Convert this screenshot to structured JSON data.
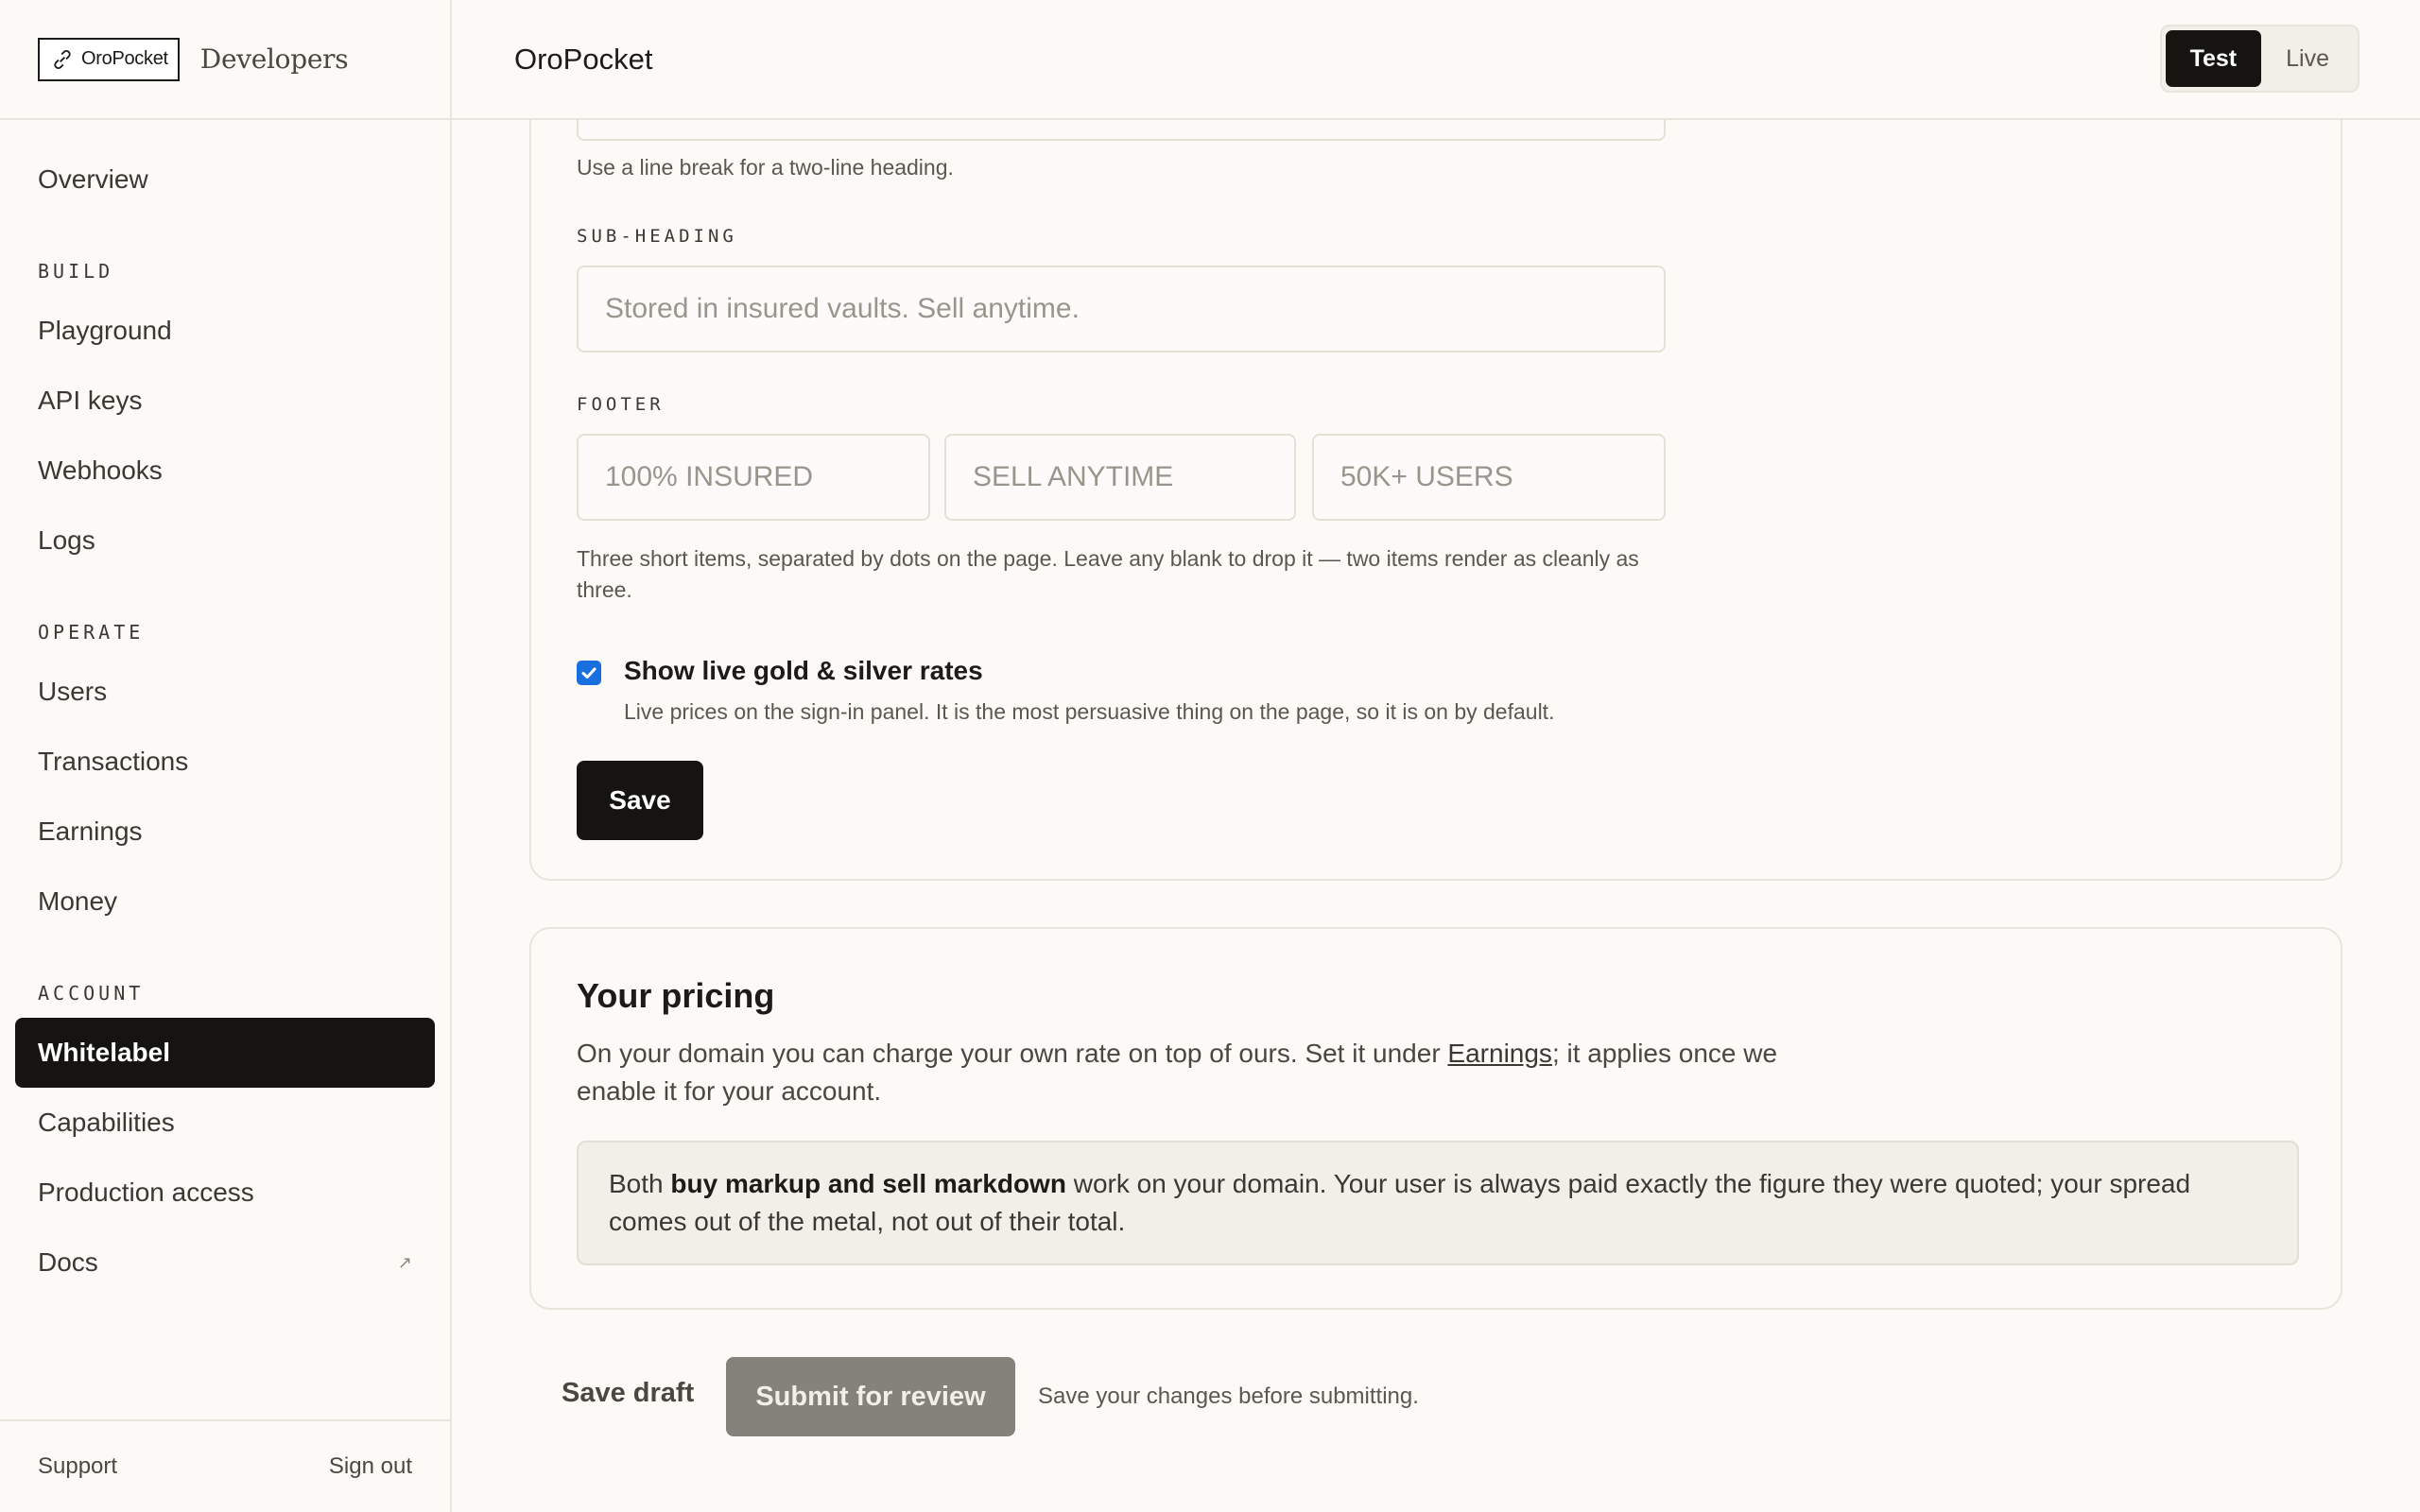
{
  "brand": {
    "logo_text": "OroPocket",
    "suffix": "Developers"
  },
  "sidebar": {
    "overview": "Overview",
    "sections": [
      {
        "title": "BUILD",
        "items": [
          "Playground",
          "API keys",
          "Webhooks",
          "Logs"
        ]
      },
      {
        "title": "OPERATE",
        "items": [
          "Users",
          "Transactions",
          "Earnings",
          "Money"
        ]
      },
      {
        "title": "ACCOUNT",
        "items": [
          "Whitelabel",
          "Capabilities",
          "Production access",
          "Docs"
        ]
      }
    ],
    "active_item": "Whitelabel",
    "external_icon": "↗",
    "footer": {
      "support": "Support",
      "sign_out": "Sign out"
    }
  },
  "topbar": {
    "title": "OroPocket",
    "modes": [
      "Test",
      "Live"
    ],
    "active_mode": "Test"
  },
  "form": {
    "heading_help": "Use a line break for a two-line heading.",
    "subheading_label": "SUB-HEADING",
    "subheading_placeholder": "Stored in insured vaults. Sell anytime.",
    "footer_label": "FOOTER",
    "footer_placeholders": [
      "100% INSURED",
      "SELL ANYTIME",
      "50K+ USERS"
    ],
    "footer_help": "Three short items, separated by dots on the page. Leave any blank to drop it — two items render as cleanly as three.",
    "rates_checkbox_label": "Show live gold & silver rates",
    "rates_checked": true,
    "rates_help": "Live prices on the sign-in panel. It is the most persuasive thing on the page, so it is on by default.",
    "save_label": "Save"
  },
  "pricing": {
    "title": "Your pricing",
    "desc_before": "On your domain you can charge your own rate on top of ours. Set it under ",
    "desc_link": "Earnings",
    "desc_after": "; it applies once we enable it for your account.",
    "callout_before": "Both ",
    "callout_bold": "buy markup and sell markdown",
    "callout_after": " work on your domain. Your user is always paid exactly the figure they were quoted; your spread comes out of the metal, not out of their total."
  },
  "actions": {
    "save_draft": "Save draft",
    "submit": "Submit for review",
    "hint": "Save your changes before submitting."
  },
  "colors": {
    "background": "#fbfaf7",
    "accent_dark": "#161411",
    "checkbox": "#1a6fe0",
    "submit_disabled": "#85827c"
  }
}
